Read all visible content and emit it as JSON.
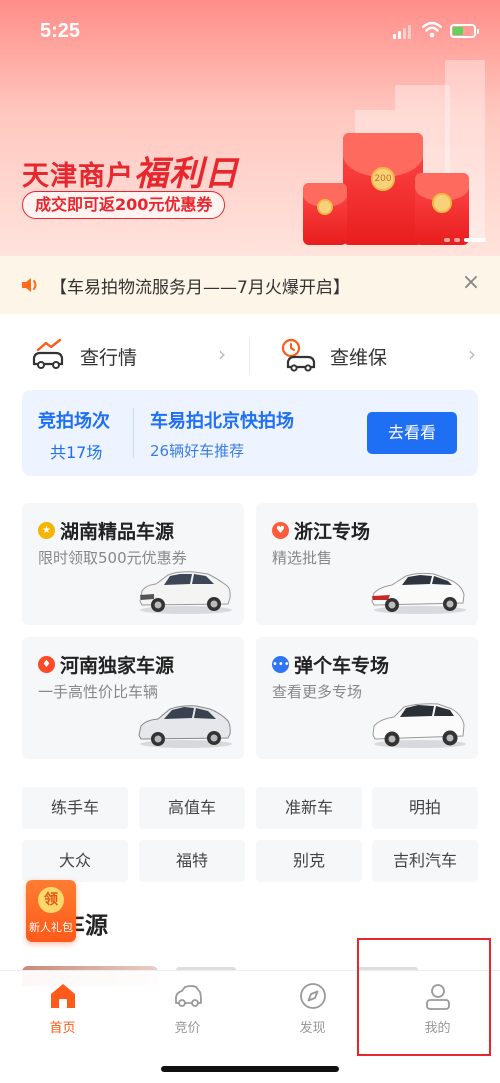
{
  "status_bar": {
    "time": "5:25"
  },
  "banner": {
    "title_prefix": "天津商户",
    "title_highlight": "福利日",
    "subtitle": "成交即可返200元优惠券",
    "coin_text": "200"
  },
  "notice": {
    "text": "【车易拍物流服务月——7月火爆开启】",
    "close": "×"
  },
  "quick_entries": [
    {
      "label": "查行情",
      "icon": "market-car-icon"
    },
    {
      "label": "查维保",
      "icon": "maintenance-car-icon"
    }
  ],
  "auction": {
    "label": "竞拍场次",
    "count": "共17场",
    "venue": "车易拍北京快拍场",
    "venue_sub": "26辆好车推荐",
    "button": "去看看"
  },
  "categories": [
    {
      "title": "湖南精品车源",
      "subtitle": "限时领取500元优惠券",
      "icon": "star-badge-icon",
      "icon_color": "#f5b400"
    },
    {
      "title": "浙江专场",
      "subtitle": "精选批售",
      "icon": "heart-badge-icon",
      "icon_color": "#ff5a3a"
    },
    {
      "title": "河南独家车源",
      "subtitle": "一手高性价比车辆",
      "icon": "flame-badge-icon",
      "icon_color": "#ff4a2a"
    },
    {
      "title": "弹个车专场",
      "subtitle": "查看更多专场",
      "icon": "more-badge-icon",
      "icon_color": "#2f74f2"
    }
  ],
  "tags": [
    "练手车",
    "高值车",
    "准新车",
    "明拍",
    "大众",
    "福特",
    "别克",
    "吉利汽车"
  ],
  "section_title": "车源",
  "gift": {
    "badge": "领",
    "label": "新人礼包"
  },
  "tabs": [
    {
      "label": "首页",
      "icon": "home-icon",
      "active": true
    },
    {
      "label": "竞价",
      "icon": "car-icon",
      "active": false
    },
    {
      "label": "发现",
      "icon": "compass-icon",
      "active": false
    },
    {
      "label": "我的",
      "icon": "profile-icon",
      "active": false
    }
  ],
  "colors": {
    "accent": "#ff5a1a",
    "brand_blue": "#1f6ff5",
    "promo_red": "#e8262e"
  }
}
